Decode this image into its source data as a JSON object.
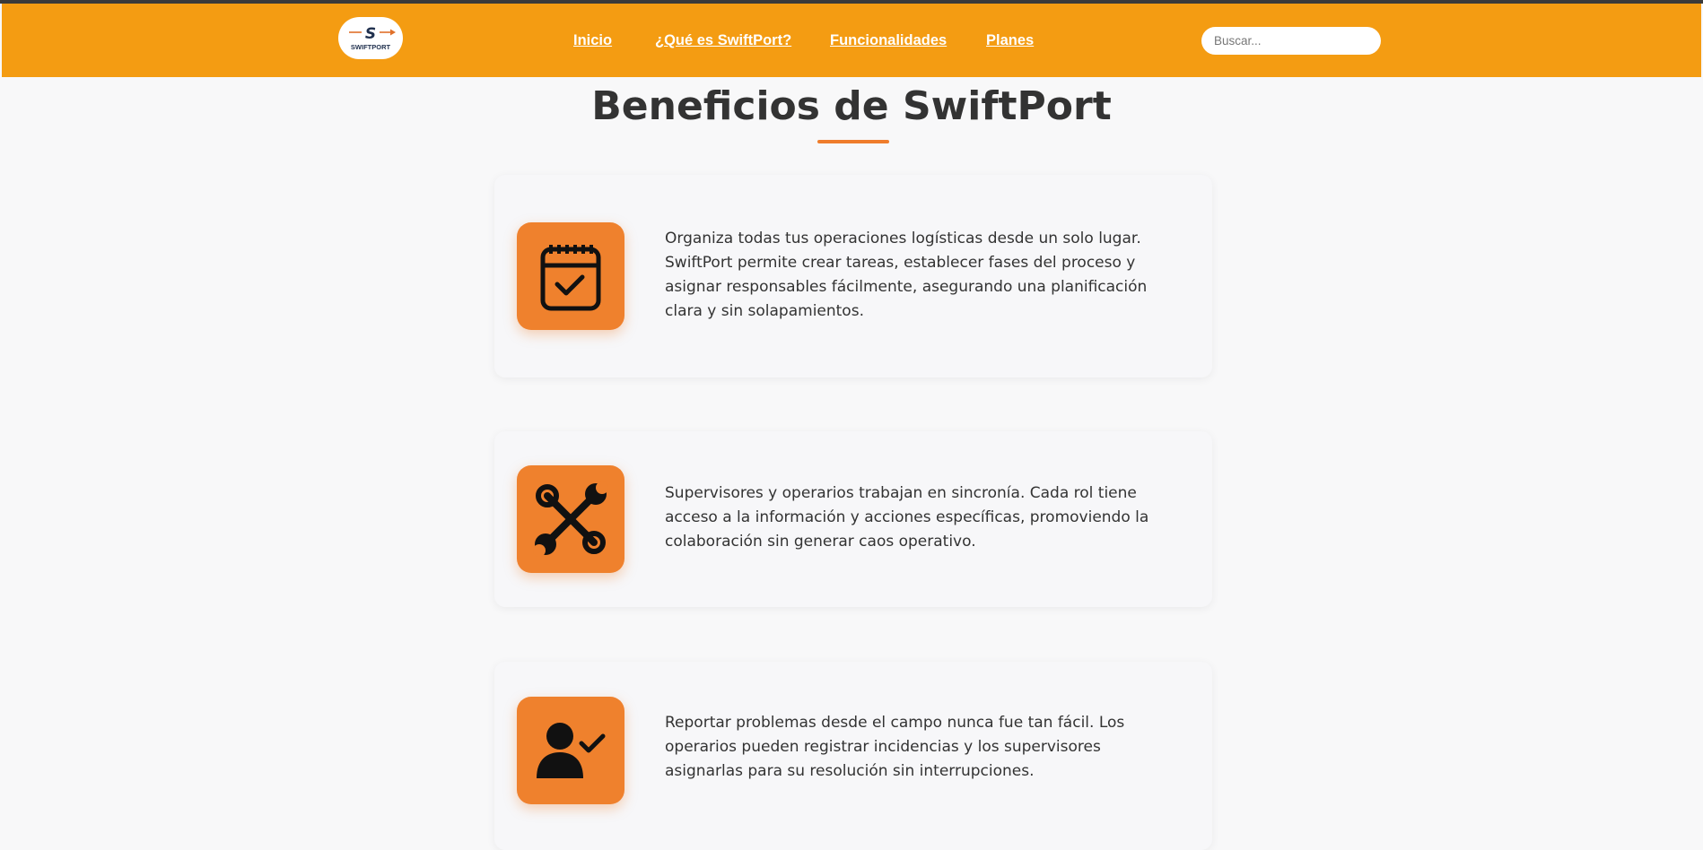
{
  "logo": {
    "letter": "S",
    "wordmark": "SWIFTPORT"
  },
  "nav": {
    "links": [
      {
        "label": "Inicio"
      },
      {
        "label": "¿Qué es SwiftPort?"
      },
      {
        "label": "Funcionalidades"
      },
      {
        "label": "Planes"
      }
    ]
  },
  "search": {
    "placeholder": "Buscar..."
  },
  "main": {
    "title": "Beneficios de SwiftPort",
    "cards": [
      {
        "icon": "calendar-check-icon",
        "text": "Organiza todas tus operaciones logísticas desde un solo lugar. SwiftPort permite crear tareas, establecer fases del proceso y asignar responsables fácilmente, asegurando una planificación clara y sin solapamientos."
      },
      {
        "icon": "tools-icon",
        "text": "Supervisores y operarios trabajan en sincronía. Cada rol tiene acceso a la información y acciones específicas, promoviendo la colaboración sin generar caos operativo."
      },
      {
        "icon": "user-check-icon",
        "text": "Reportar problemas desde el campo nunca fue tan fácil. Los operarios pueden registrar incidencias y los supervisores asignarlas para su resolución sin interrupciones."
      }
    ]
  },
  "colors": {
    "navbar": "#f49c12",
    "accent": "#ef812d",
    "text": "#333333",
    "background": "#f8f8f9"
  }
}
